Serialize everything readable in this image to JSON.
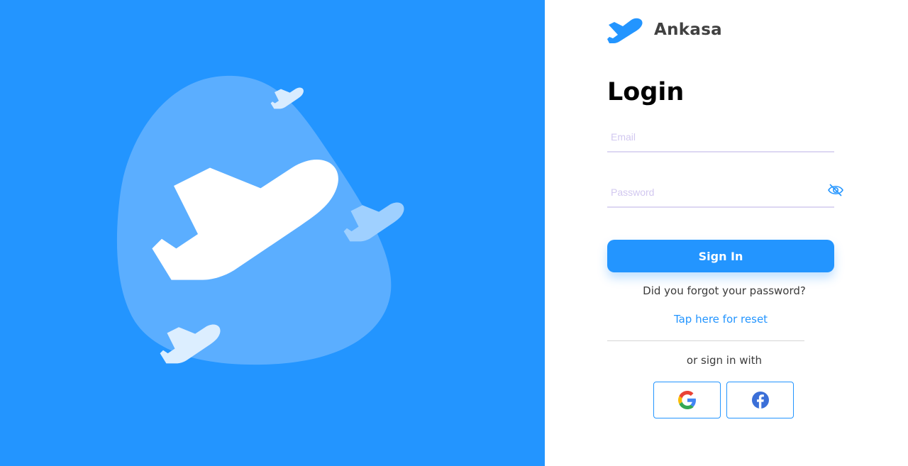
{
  "brand": {
    "name": "Ankasa",
    "logo_icon": "plane-logo-icon",
    "primary_color": "#2395FF"
  },
  "illustration": {
    "background_color": "#2395FF",
    "blob_color": "#5BAEFF",
    "icons": [
      "large-plane-icon",
      "small-plane-icon"
    ]
  },
  "login": {
    "title": "Login",
    "email": {
      "placeholder": "Email",
      "value": ""
    },
    "password": {
      "placeholder": "Password",
      "value": "",
      "toggle_icon": "eye-off-icon"
    },
    "signin_label": "Sign In",
    "forgot_text": "Did you forgot your password?",
    "reset_link": "Tap here for reset",
    "social_text": "or sign in with",
    "social": [
      {
        "name": "Google",
        "icon": "google-icon"
      },
      {
        "name": "Facebook",
        "icon": "facebook-icon"
      }
    ]
  }
}
